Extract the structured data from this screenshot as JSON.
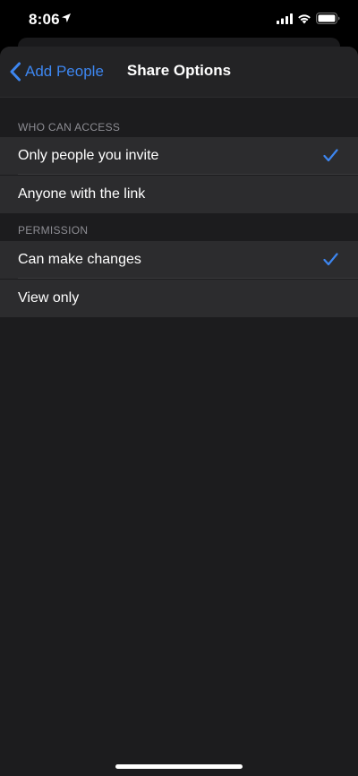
{
  "status_bar": {
    "time": "8:06",
    "icons": [
      "location-arrow-icon",
      "signal-icon",
      "wifi-icon",
      "battery-icon"
    ]
  },
  "nav": {
    "back_label": "Add People",
    "title": "Share Options"
  },
  "sections": [
    {
      "header": "WHO CAN ACCESS",
      "rows": [
        {
          "label": "Only people you invite",
          "selected": true
        },
        {
          "label": "Anyone with the link",
          "selected": false
        }
      ]
    },
    {
      "header": "PERMISSION",
      "rows": [
        {
          "label": "Can make changes",
          "selected": true
        },
        {
          "label": "View only",
          "selected": false
        }
      ]
    }
  ],
  "colors": {
    "accent": "#3d86f0",
    "sheet_background": "#1c1c1e",
    "row_background": "#2c2c2e",
    "section_header": "#8d8d93"
  }
}
